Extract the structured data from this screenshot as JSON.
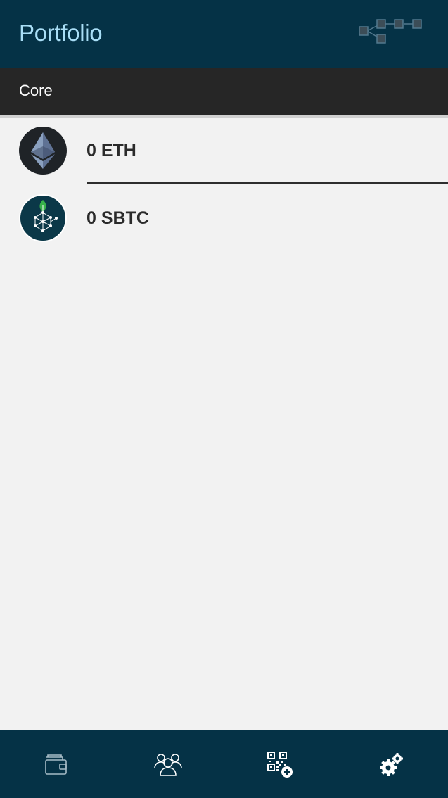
{
  "header": {
    "title": "Portfolio",
    "menu_icon": "network-diagram-icon",
    "title_color": "#a9def6",
    "background_color": "#053246"
  },
  "section": {
    "title": "Core"
  },
  "assets": [
    {
      "amount": "0 ETH",
      "icon": "ethereum-logo-icon"
    },
    {
      "amount": "0 SBTC",
      "icon": "sbtc-logo-icon"
    }
  ],
  "bottom_nav": {
    "items": [
      {
        "icon": "wallet-icon"
      },
      {
        "icon": "contacts-icon"
      },
      {
        "icon": "qr-code-add-icon"
      },
      {
        "icon": "settings-gears-icon"
      }
    ]
  }
}
